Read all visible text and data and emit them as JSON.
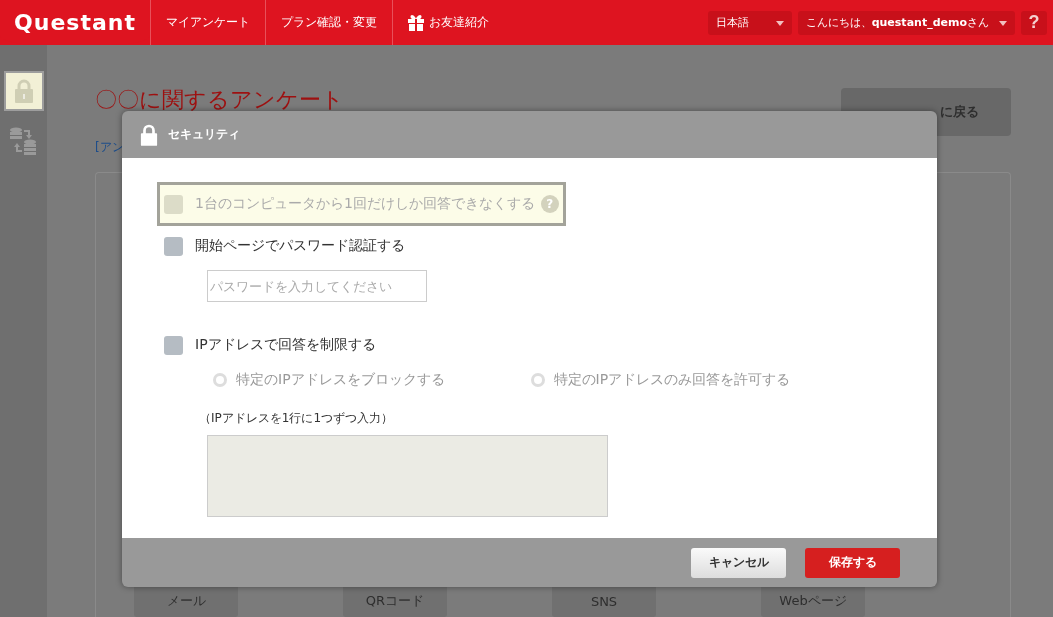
{
  "header": {
    "logo": "Questant",
    "nav": [
      {
        "kind": "text",
        "label": "マイアンケート"
      },
      {
        "kind": "text",
        "label": "プラン確認・変更"
      },
      {
        "kind": "gift",
        "label": "お友達紹介"
      }
    ],
    "language": "日本語",
    "greeting": "こんにちは、**questant_demo**さん",
    "help": "?"
  },
  "sidebar": {
    "items": [
      {
        "kind": "lock",
        "selected": true
      },
      {
        "kind": "transfer",
        "selected": false
      }
    ]
  },
  "page": {
    "title": "〇〇に関するアンケート",
    "link": "[アン",
    "back_button": "に戻る",
    "share_buttons": [
      "メール",
      "QRコード",
      "SNS",
      "Webページ"
    ]
  },
  "modal": {
    "title": "セキュリティ",
    "items": [
      {
        "kind": "checkbox",
        "label": "1台のコンピュータから1回だけしか回答できなくする",
        "checked": false,
        "disabled": true,
        "highlighted": true,
        "help": "?"
      },
      {
        "kind": "checkbox",
        "label": "開始ページでパスワード認証する",
        "checked": false,
        "disabled": false,
        "highlighted": false
      },
      {
        "kind": "password",
        "placeholder": "パスワードを入力してください"
      },
      {
        "kind": "checkbox",
        "label": "IPアドレスで回答を制限する",
        "checked": false,
        "disabled": false,
        "highlighted": false
      },
      {
        "kind": "radios",
        "options": [
          {
            "label": "特定のIPアドレスをブロックする",
            "selected": false
          },
          {
            "label": "特定のIPアドレスのみ回答を許可する",
            "selected": false
          }
        ]
      },
      {
        "kind": "note",
        "label": "（IPアドレスを1行に1つずつ入力）"
      },
      {
        "kind": "textarea",
        "disabled": true
      }
    ],
    "buttons": [
      {
        "kind": "cancel",
        "label": "キャンセル"
      },
      {
        "kind": "save",
        "label": "保存する"
      }
    ]
  }
}
